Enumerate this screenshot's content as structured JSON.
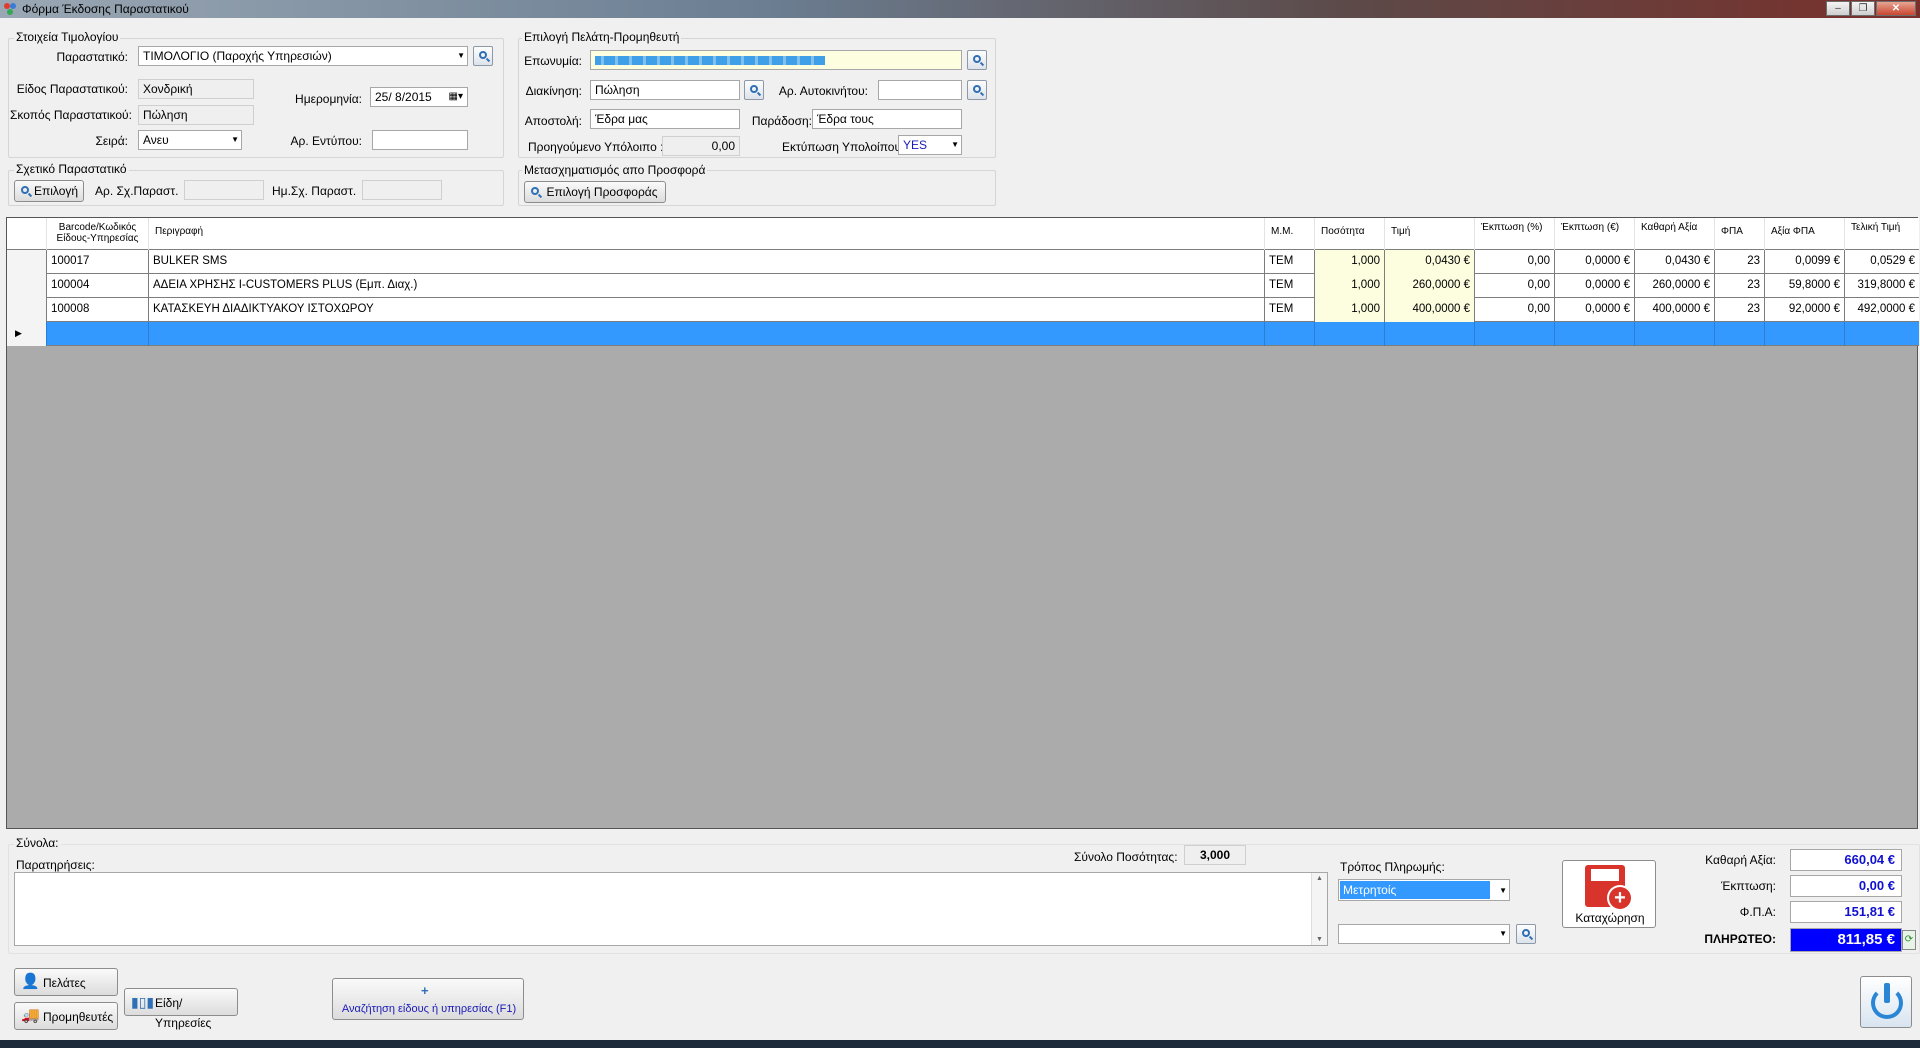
{
  "window": {
    "title": "Φόρμα Έκδοσης Παραστατικού"
  },
  "invoice": {
    "group_title": "Στοιχεία Τιμολογίου",
    "doc_label": "Παραστατικό:",
    "doc_value": "ΤΙΜΟΛΟΓΙΟ (Παροχής Υπηρεσιών)",
    "type_label": "Είδος Παραστατικού:",
    "type_value": "Χονδρική",
    "purpose_label": "Σκοπός Παραστατικού:",
    "purpose_value": "Πώληση",
    "series_label": "Σειρά:",
    "series_value": "Ανευ",
    "date_label": "Ημερομηνία:",
    "date_value": "25/ 8/2015",
    "form_no_label": "Αρ. Εντύπου:",
    "form_no_value": ""
  },
  "related": {
    "group_title": "Σχετικό Παραστατικό",
    "select_label": "Επιλογή",
    "no_label": "Αρ. Σχ.Παραστ.",
    "date_label": "Ημ.Σχ. Παραστ."
  },
  "customer": {
    "group_title": "Επιλογή Πελάτη-Προμηθευτή",
    "name_label": "Επωνυμία:",
    "name_value": "",
    "transit_label": "Διακίνηση:",
    "transit_value": "Πώληση",
    "vehicle_label": "Αρ. Αυτοκινήτου:",
    "vehicle_value": "",
    "dispatch_label": "Αποστολή:",
    "dispatch_value": "Έδρα μας",
    "delivery_label": "Παράδοση:",
    "delivery_value": "Έδρα τους",
    "prev_balance_label": "Προηγούμενο Υπόλοιπο :",
    "prev_balance_value": "0,00",
    "print_balance_label": "Εκτύπωση Υπολοίπου:",
    "print_balance_value": "YES"
  },
  "offer": {
    "group_title": "Μετασχηματισμός απο Προσφορά",
    "select_label": "Επιλογή Προσφοράς"
  },
  "grid": {
    "headers": [
      "Barcode/Κωδικός Είδους-Υπηρεσίας",
      "Περιγραφή",
      "Μ.Μ.",
      "Ποσότητα",
      "Τιμή",
      "Έκπτωση (%)",
      "Έκπτωση (€)",
      "Καθαρή Αξία",
      "ΦΠΑ",
      "Αξία ΦΠΑ",
      "Τελική Τιμή"
    ],
    "rows": [
      {
        "code": "100017",
        "desc": "BULKER SMS",
        "mm": "ΤΕΜ",
        "qty": "1,000",
        "price": "0,0430 €",
        "disc_pct": "0,00",
        "disc_eur": "0,0000 €",
        "net": "0,0430 €",
        "vat": "23",
        "vat_amt": "0,0099 €",
        "final": "0,0529 €"
      },
      {
        "code": "100004",
        "desc": "ΑΔΕΙΑ ΧΡΗΣΗΣ I-CUSTOMERS PLUS     (Εμπ. Διαχ.)",
        "mm": "ΤΕΜ",
        "qty": "1,000",
        "price": "260,0000 €",
        "disc_pct": "0,00",
        "disc_eur": "0,0000 €",
        "net": "260,0000 €",
        "vat": "23",
        "vat_amt": "59,8000 €",
        "final": "319,8000 €"
      },
      {
        "code": "100008",
        "desc": "ΚΑΤΑΣΚΕΥΗ ΔΙΑΔΙΚΤΥΑΚΟΥ ΙΣΤΟΧΩΡΟΥ",
        "mm": "ΤΕΜ",
        "qty": "1,000",
        "price": "400,0000 €",
        "disc_pct": "0,00",
        "disc_eur": "0,0000 €",
        "net": "400,0000 €",
        "vat": "23",
        "vat_amt": "92,0000 €",
        "final": "492,0000 €"
      }
    ]
  },
  "totals": {
    "section_label": "Σύνολα:",
    "notes_label": "Παρατηρήσεις:",
    "notes_value": "",
    "qty_total_label": "Σύνολο Ποσότητας:",
    "qty_total_value": "3,000",
    "payment_label": "Τρόπος Πληρωμής:",
    "payment_value": "Μετρητοίς",
    "save_label": "Καταχώρηση",
    "net_label": "Καθαρή Αξία:",
    "net_value": "660,04 €",
    "discount_label": "Έκπτωση:",
    "discount_value": "0,00 €",
    "vat_label": "Φ.Π.Α:",
    "vat_value": "151,81 €",
    "payable_label": "ΠΛΗΡΩΤΕΟ:",
    "payable_value": "811,85 €"
  },
  "footer": {
    "customers_label": "Πελάτες",
    "suppliers_label": "Προμηθευτές",
    "items_label": "Είδη/Υπηρεσίες",
    "search_label": "Αναζήτηση είδους ή υπηρεσίας (F1)"
  },
  "colors": {
    "selected_row": "#3399ff",
    "payable_bg": "#0000ff",
    "totals_text": "#1010d0",
    "save_red": "#d9342b"
  }
}
